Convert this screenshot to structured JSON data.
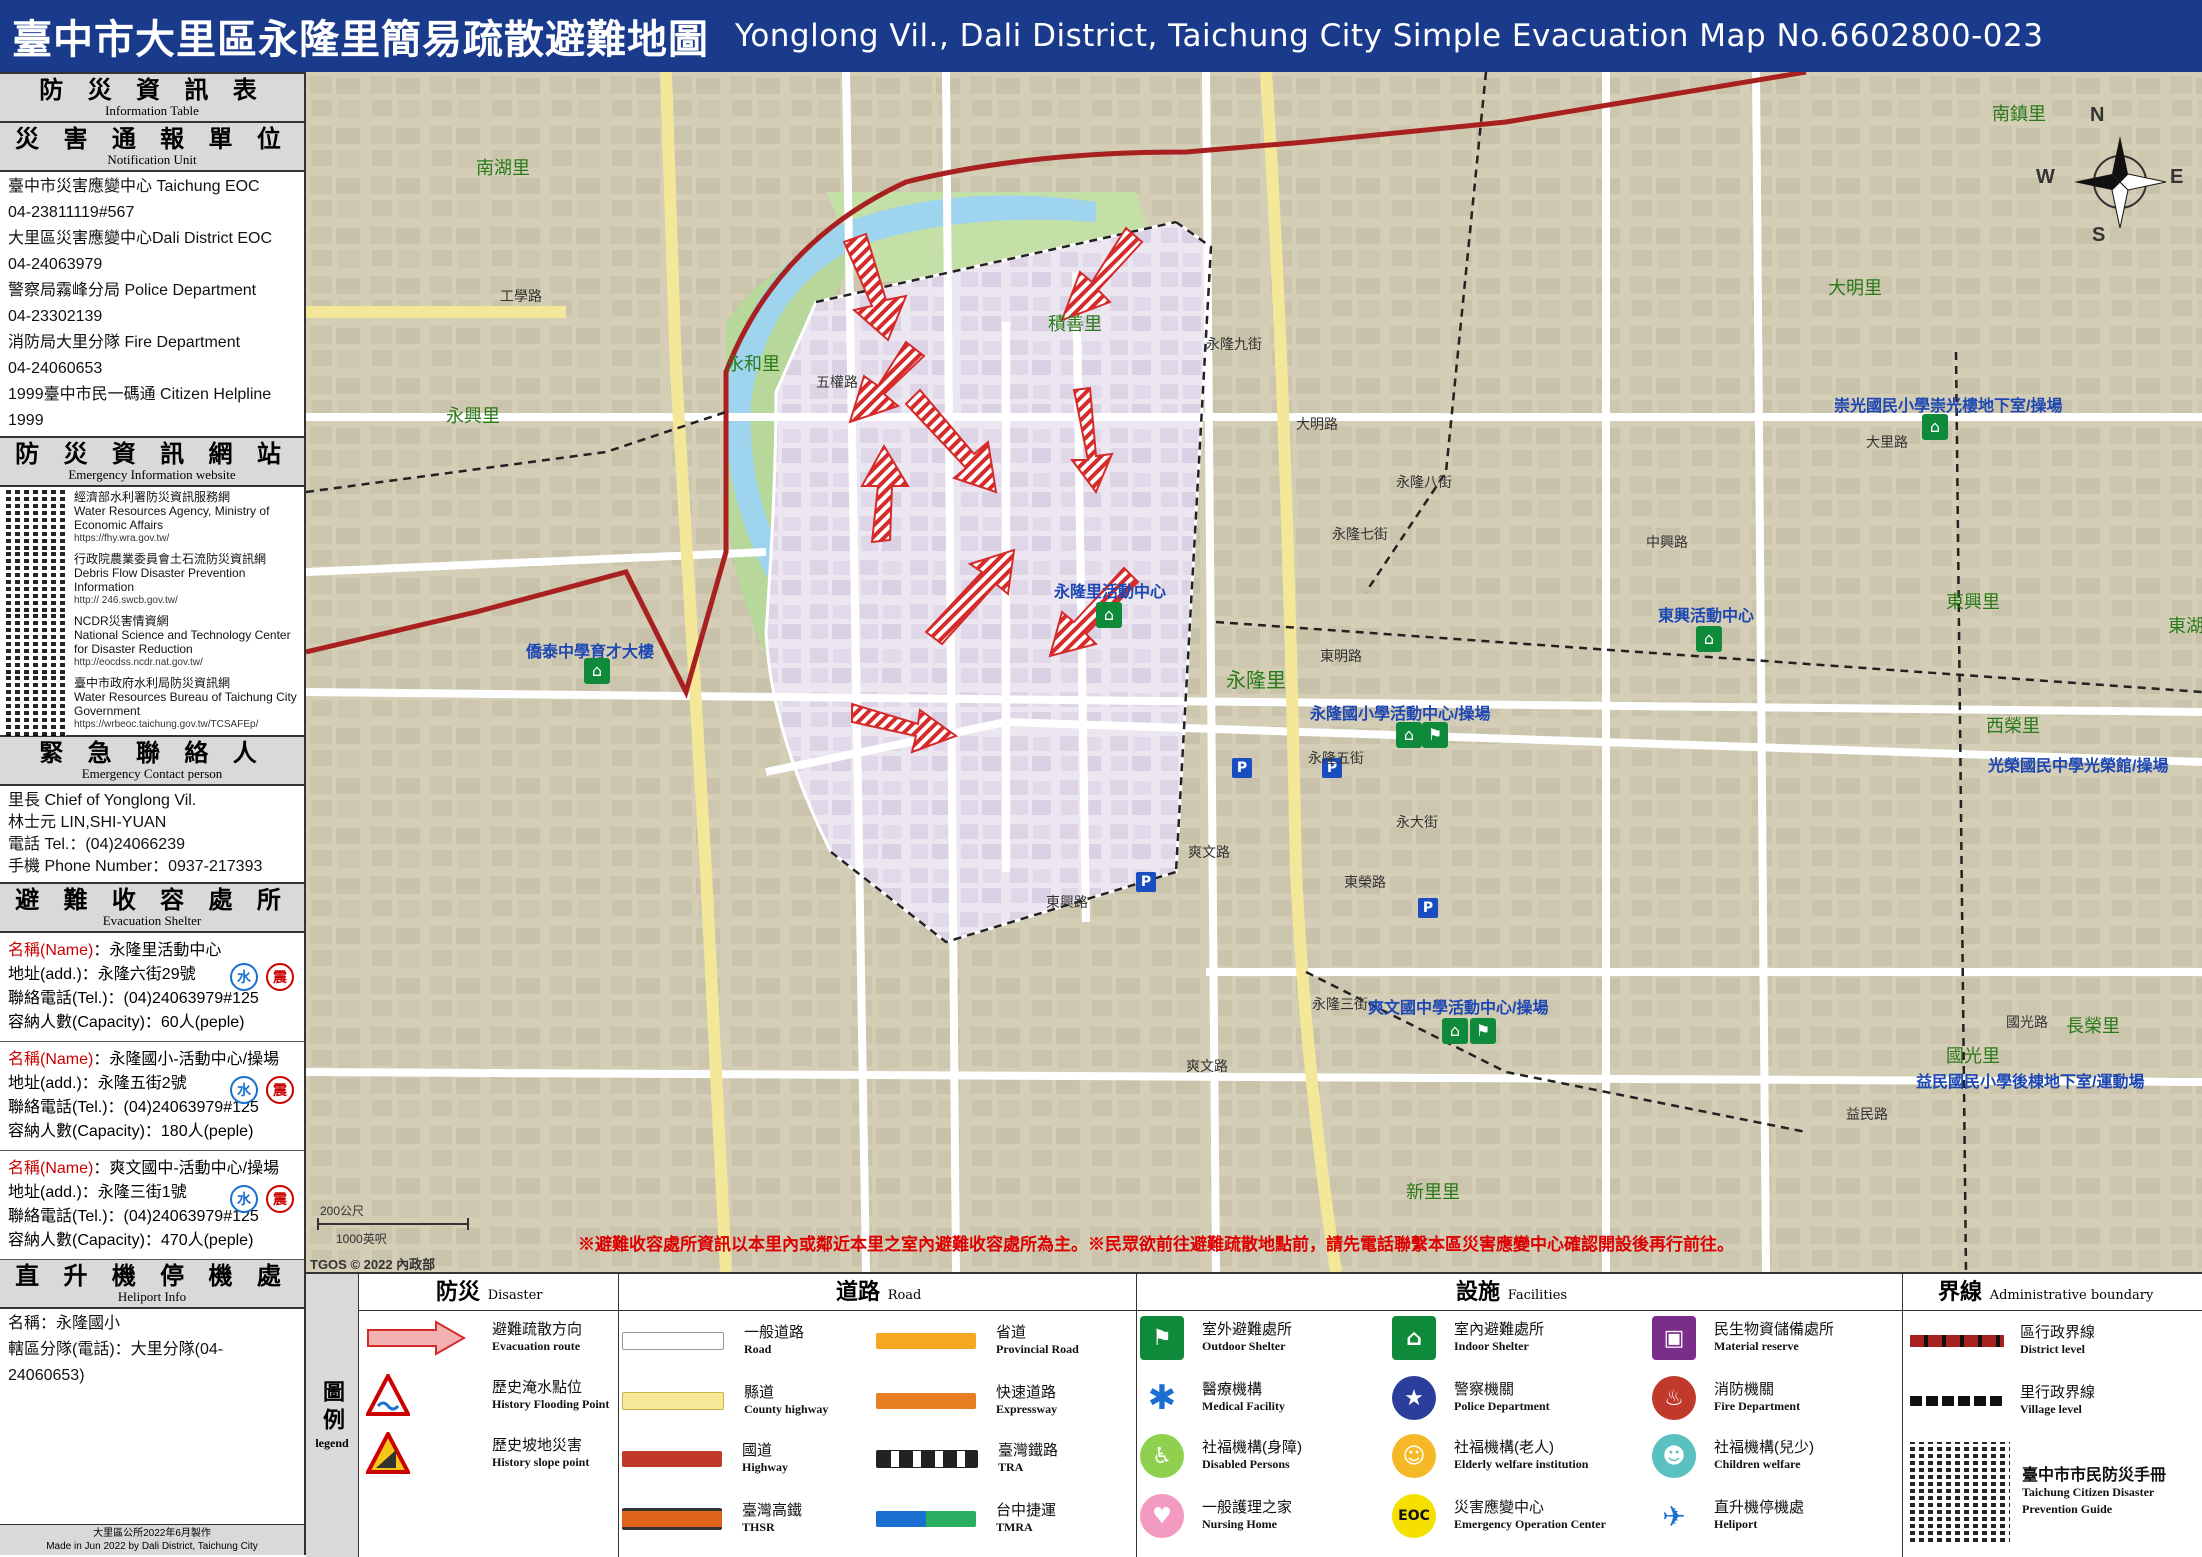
{
  "title": {
    "zh": "臺中市大里區永隆里簡易疏散避難地圖",
    "en": "Yonglong Vil., Dali District, Taichung City Simple Evacuation Map No.6602800-023"
  },
  "left_panel": {
    "info_table": {
      "zh": "防 災 資 訊 表",
      "en": "Information Table"
    },
    "notification_unit": {
      "zh": "災 害 通 報 單 位",
      "en": "Notification Unit"
    },
    "contacts": [
      "臺中市災害應變中心 Taichung EOC",
      "04-23811119#567",
      "大里區災害應變中心Dali District EOC",
      "04-24063979",
      "警察局霧峰分局 Police Department",
      "04-23302139",
      "消防局大里分隊 Fire Department",
      "04-24060653",
      "1999臺中市民一碼通 Citizen Helpline",
      "1999"
    ],
    "web_header": {
      "zh": "防 災 資 訊 網 站",
      "en": "Emergency Information website"
    },
    "websites": [
      {
        "name": "經濟部水利署防災資訊服務網",
        "en": "Water Resources Agency, Ministry of Economic Affairs",
        "url": "https://fhy.wra.gov.tw/"
      },
      {
        "name": "行政院農業委員會土石流防災資訊網",
        "en": "Debris Flow Disaster Prevention Information",
        "url": "http:// 246.swcb.gov.tw/"
      },
      {
        "name": "NCDR災害情資網",
        "en": "National Science and Technology Center for Disaster Reduction",
        "url": "http://eocdss.ncdr.nat.gov.tw/"
      },
      {
        "name": "臺中市政府水利局防災資訊網",
        "en": "Water Resources Bureau of Taichung City Government",
        "url": "https://wrbeoc.taichung.gov.tw/TCSAFEp/"
      }
    ],
    "emergency_header": {
      "zh": "緊 急 聯 絡 人",
      "en": "Emergency Contact person"
    },
    "emergency_lines": [
      "里長 Chief of Yonglong Vil.",
      "林士元 LIN,SHI-YUAN",
      "電話 Tel.：(04)24066239",
      "手機 Phone Number：0937-217393"
    ],
    "shelter_header": {
      "zh": "避 難 收 容 處 所",
      "en": "Evacuation Shelter"
    },
    "shelters": [
      {
        "name_label": "名稱(Name)",
        "name": "：永隆里活動中心",
        "addr": "地址(add.)：永隆六街29號",
        "tel": "聯絡電話(Tel.)：(04)24063979#125",
        "cap": "容納人數(Capacity)：60人(peple)",
        "badge_water": "水",
        "badge_quake": "震"
      },
      {
        "name_label": "名稱(Name)",
        "name": "：永隆國小-活動中心/操場",
        "addr": "地址(add.)：永隆五街2號",
        "tel": "聯絡電話(Tel.)：(04)24063979#125",
        "cap": "容納人數(Capacity)：180人(peple)",
        "badge_water": "水",
        "badge_quake": "震"
      },
      {
        "name_label": "名稱(Name)",
        "name": "：爽文國中-活動中心/操場",
        "addr": "地址(add.)：永隆三街1號",
        "tel": "聯絡電話(Tel.)：(04)24063979#125",
        "cap": "容納人數(Capacity)：470人(peple)",
        "badge_water": "水",
        "badge_quake": "震"
      }
    ],
    "heliport_header": {
      "zh": "直 升 機 停 機 處",
      "en": "Heliport Info"
    },
    "heliport_lines": [
      "名稱：永隆國小",
      "轄區分隊(電話)：大里分隊(04-24060653)"
    ],
    "footer_zh": "大里區公所2022年6月製作",
    "footer_en": "Made in Jun 2022 by Dali District, Taichung City"
  },
  "map": {
    "copyright": "TGOS © 2022 內政部",
    "scale_m": "200公尺",
    "scale_ft": "1000英呎",
    "compass": {
      "n": "N",
      "s": "S",
      "e": "E",
      "w": "W"
    },
    "notice": "※避難收容處所資訊以本里內或鄰近本里之室內避難收容處所為主。※民眾欲前往避難疏散地點前，請先電話聯繫本區災害應變中心確認開設後再行前往。",
    "village_labels": [
      "永隆里",
      "南湖里",
      "永和里",
      "積善里",
      "永興里",
      "大明里",
      "東興里",
      "東湖里",
      "新里里",
      "國光里",
      "西榮里",
      "長榮里",
      "南鎮里"
    ],
    "shelter_labels": [
      "永隆里活動中心",
      "永隆國小學活動中心/操場",
      "爽文國中學活動中心/操場",
      "崇光國民小學崇光樓地下室/操場",
      "東興活動中心",
      "僑泰中學育才大樓",
      "光榮國民中學光榮館/操場",
      "益民國民小學後棟地下室/運動場"
    ],
    "street_labels": [
      "大明路",
      "永隆七街",
      "永隆五街",
      "東榮路",
      "爽文路",
      "永隆三街",
      "東明路",
      "永大街",
      "益民路",
      "中興路",
      "大里路",
      "五權路",
      "東興路",
      "國光路",
      "永隆八街",
      "永隆九街",
      "工學路",
      "爽文路"
    ]
  },
  "legend": {
    "title_zh": "圖例",
    "title_en": "legend",
    "cat_disaster": {
      "zh": "防災",
      "en": "Disaster"
    },
    "cat_road": {
      "zh": "道路",
      "en": "Road"
    },
    "cat_facilities": {
      "zh": "設施",
      "en": "Facilities"
    },
    "cat_boundary": {
      "zh": "界線",
      "en": "Administrative boundary"
    },
    "disaster": [
      {
        "zh": "避難疏散方向",
        "en": "Evacuation route"
      },
      {
        "zh": "歷史淹水點位",
        "en": "History Flooding Point"
      },
      {
        "zh": "歷史坡地災害",
        "en": "History slope point"
      }
    ],
    "roads": [
      {
        "zh": "一般道路",
        "en": "Road",
        "color": "#ffffff"
      },
      {
        "zh": "縣道",
        "en": "County highway",
        "color": "#f7e99a"
      },
      {
        "zh": "國道",
        "en": "Highway",
        "color": "#c0392b"
      },
      {
        "zh": "臺灣高鐵",
        "en": "THSR",
        "color": "#e0631c"
      },
      {
        "zh": "省道",
        "en": "Provincial Road",
        "color": "#f5a623"
      },
      {
        "zh": "快速道路",
        "en": "Expressway",
        "color": "#e67e22"
      },
      {
        "zh": "臺灣鐵路",
        "en": "TRA",
        "color": "#222222"
      },
      {
        "zh": "台中捷運",
        "en": "TMRA",
        "color": "#27ae60"
      }
    ],
    "facilities": [
      {
        "zh": "室外避難處所",
        "en": "Outdoor Shelter",
        "color": "#0f8a3a",
        "icon": "outdoor-shelter-icon"
      },
      {
        "zh": "醫療機構",
        "en": "Medical Facility",
        "color": "#1b6fd0",
        "icon": "medical-icon"
      },
      {
        "zh": "社福機構(身障)",
        "en": "Disabled Persons",
        "color": "#8fd14f",
        "icon": "disabled-icon"
      },
      {
        "zh": "一般護理之家",
        "en": "Nursing Home",
        "color": "#f39ac0",
        "icon": "nursing-icon"
      },
      {
        "zh": "室內避難處所",
        "en": "Indoor Shelter",
        "color": "#0f8a3a",
        "icon": "indoor-shelter-icon"
      },
      {
        "zh": "警察機關",
        "en": "Police Department",
        "color": "#2c3e9c",
        "icon": "police-icon"
      },
      {
        "zh": "社福機構(老人)",
        "en": "Elderly welfare institution",
        "color": "#f5b827",
        "icon": "elderly-icon"
      },
      {
        "zh": "災害應變中心",
        "en": "Emergency Operation Center",
        "color": "#f5e000",
        "icon": "eoc-icon",
        "text": "EOC"
      },
      {
        "zh": "民生物資儲備處所",
        "en": "Material reserve",
        "color": "#7b2d8a",
        "icon": "reserve-icon"
      },
      {
        "zh": "消防機關",
        "en": "Fire Department",
        "color": "#c0392b",
        "icon": "fire-icon"
      },
      {
        "zh": "社福機構(兒少)",
        "en": "Children welfare",
        "color": "#5bc0c0",
        "icon": "children-icon"
      },
      {
        "zh": "直升機停機處",
        "en": "Heliport",
        "color": "#1b6fd0",
        "icon": "heliport-icon"
      }
    ],
    "boundaries": [
      {
        "zh": "區行政界線",
        "en": "District level"
      },
      {
        "zh": "里行政界線",
        "en": "Village level"
      }
    ],
    "guide_zh": "臺中市市民防災手冊",
    "guide_en": "Taichung Citizen Disaster Prevention Guide"
  }
}
